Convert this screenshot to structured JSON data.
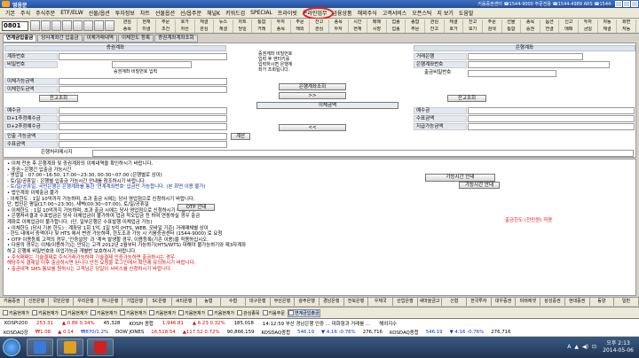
{
  "titlebar": {
    "title": "영웅문",
    "info": "키움증권센터  ☎1544-9000 주문전용 ☎1544-4989 ARS ☎1544-"
  },
  "menu": [
    "기본",
    "주식",
    "주식주문",
    "ETF/ELW",
    "선물/옵션",
    "투자정보",
    "차트",
    "선물옵션",
    "선/옵주문",
    "채널K",
    "키워드검",
    "SPECIAL",
    "프라이빗",
    "온라인업무",
    "금융상품",
    "해외주식",
    "고객서비스",
    "오픈스틱",
    "지 보기",
    "도움말"
  ],
  "account_number": "0801",
  "quick": [
    "관심",
    "현재",
    "주문",
    "호가",
    "체결",
    "뉴스",
    "차트",
    "통합",
    "투자",
    "주문",
    "잔고",
    "종목",
    "시간",
    "매매",
    "업종",
    "종합",
    "관심",
    "체결",
    "잔고",
    "주문",
    "선물",
    "종목",
    "옵션",
    "신고",
    "투자",
    "자동",
    "화면",
    "종목",
    "미결",
    "조건",
    "자산",
    "관심",
    "체결",
    "당일",
    "거래",
    "종목",
    "해외",
    "관심",
    "투자",
    "현재",
    "시장",
    "업종",
    "주문",
    "잔고",
    "호가",
    "보기",
    "검색",
    "통합",
    "증권",
    "연결",
    "매매",
    "금일",
    "체결",
    "자동"
  ],
  "tabs": [
    "연계금입출금",
    "당사계좌간 입출금",
    "이체거래내역",
    "이체한도 등록",
    "증권계좌계좌조회"
  ],
  "panel": {
    "left_header": "증권계좌",
    "account_label": "계좌번호",
    "password_label": "비밀번호",
    "password_hint": "증권계좌 비밀번호 입력",
    "transfer_available_label": "이체가능금액",
    "transfer_limit_label": "이체한도금액",
    "balance_btn": "잔고조회",
    "deposit_label": "예수금",
    "d1_label": "D+1추정예수금",
    "d2_label": "D+2추정예수금",
    "withdraw_label": "인출 가능금액",
    "fee_label": "수표금액",
    "calc_btn": "계산",
    "bank_message_label": "은행처리메시지",
    "mid_text": [
      "증권계좌 비밀번호",
      "입력 후 엔터키를",
      "입력하시면 은행계",
      "좌가 조회됩니다."
    ],
    "mid_btn_query": "은행계좌조회",
    "mid_btn_right": ">>",
    "mid_btn_amount": "이체금액",
    "mid_btn_left": "<<",
    "right_header": "은행계좌",
    "bank_name_label": "거래은행",
    "bank_account_label": "은행계좌번호",
    "bank_pw_label": "출금비밀번호",
    "right_balance_btn": "잔고조회",
    "bank_deposit_label": "예수금",
    "bank_fee_label": "수표금액",
    "bank_withdraw_label": "지급가능금액"
  },
  "notes": [
    {
      "t": "• 이체 전송 후 은행계좌 및 증권계좌의 이체내역을 확인하시기 바랍니다.",
      "c": ""
    },
    {
      "t": "• 증권~은행간 입출금 가능시간",
      "c": ""
    },
    {
      "t": "   - 영업일 : 07:00~16:50, 17:00~23:30, 00:30~07:00 (은행별로 상이)",
      "c": ""
    },
    {
      "t": "   - 토/일/공휴일 : 은행별 입출금 가능시간 안내를 참조하시기 바랍니다.",
      "c": ""
    },
    {
      "t": "   - 토/일/공휴일, 국민은행은 은행계좌를 통한 '연계계좌번호' 입금만 가능합니다. (본 화면 이용 불가)",
      "c": "blue"
    },
    {
      "t": "• 법인계좌 이체출금 불가",
      "c": ""
    },
    {
      "t": "   - 이체한도 : 1일 10억까지 가능하며, 초과 출금 시에는 당사 영업점으로 신청하시기 바랍니다.",
      "c": ""
    },
    {
      "t": "                         단, 법인은 평일(17:00~23:30), 새벽(00:30~07:00), 토/일/공휴일",
      "c": ""
    },
    {
      "t": "• 이체한도 : 1일 10억까지 가능하며, 초과 출금 시에는 당사 영업점으로 신청하시기 바랍니다.",
      "c": ""
    },
    {
      "t": "• 은행처리결과 수표법금은 당사 이체업금이 불가하여 업금 착오입금 전 하여 연동하실 경우 출금",
      "c": ""
    },
    {
      "t": "   계좌로 이체업금이 불가합니다. (단, 일부은행은 수표발행 이체업금 가능)",
      "c": ""
    },
    {
      "t": "• 이체한도 (당사 기본 한도) : 계좌당 1회 1억, 1일 5억 (HTS, WEB, 모바일 기준) 거래매체별 상이",
      "c": ""
    },
    {
      "t": "   - 한도 내에서 증액이나 및 HTS 에서 변경 가능하며, 한도조과 가능 시 키움증권센터 (1544-9000) 로 요청",
      "c": ""
    },
    {
      "t": "• OTP 이용등록 고객의 경우, '인증설정' 과 '계속 발생할 경우, 이용등록(기존 이용)을 적용하십시오.",
      "c": ""
    },
    {
      "t": "• 다음의 경우는 이체(이용하기)는 안되는 고객 2012년 2월부터 가능하기(HTS/WTS) 대해야 불가능하기와 제3자계좌",
      "c": ""
    },
    {
      "t": "   하고 은행에 비밀번호와 이업가능금 개별번 보호하시기 바랍니다.",
      "c": ""
    },
    {
      "t": "• 주식매매는 기술결제로 주식거래가능하며 기술결제 인증가능하면 출금하시는 경우",
      "c": "red"
    },
    {
      "t": "   해당주식 결제일 이후 출금하시면 된니다.안전 요청을 로그인에서 확인에 유의하시기 바랍니다.",
      "c": "red"
    },
    {
      "t": "• 출금내역 SMS 통보를 원하시는 고객님은 당일이 서비스를 신청하시기 바랍니다.",
      "c": "red"
    }
  ],
  "access_btn": "가능시간 안내",
  "access_btn2": "가능시간 안내",
  "otp_btn": "OTP 안내",
  "notice": "출금한도 (천만원) 적용",
  "tickers": [
    "키움증권",
    "신한은행",
    "국민은행",
    "우리은행",
    "하나은행",
    "기업은행",
    "SC은행",
    "씨티은행",
    "농협",
    "수협",
    "대구은행",
    "부산은행",
    "광주은행",
    "경남은행",
    "전북은행",
    "우체국",
    "산업은행",
    "새마을금고",
    "신협",
    "한국투자",
    "대우증권",
    "미래에셋",
    "삼성증권",
    "현대증권",
    "동양",
    "일반"
  ],
  "windows": [
    {
      "label": "키움현재가",
      "act": false
    },
    {
      "label": "키움현재가",
      "act": false
    },
    {
      "label": "키움현재가",
      "act": false
    },
    {
      "label": "키움현재가",
      "act": false
    },
    {
      "label": "키움현재가",
      "act": false
    },
    {
      "label": "키움현재가",
      "act": false
    },
    {
      "label": "키움현재가",
      "act": false
    },
    {
      "label": "키움현재가",
      "act": false
    },
    {
      "label": "관심종목",
      "act": false
    },
    {
      "label": "키움주문",
      "act": false
    },
    {
      "label": "연계금입출금",
      "act": true
    }
  ],
  "market_row1": [
    {
      "t": "KOSPI200",
      "c": ""
    },
    {
      "t": "253.31",
      "c": "up"
    },
    {
      "t": "▲ 0.86 0.34%",
      "c": "up"
    },
    {
      "t": "45,328",
      "c": ""
    },
    {
      "t": "KOSPI 종합",
      "c": ""
    },
    {
      "t": "1,946.81",
      "c": "up"
    },
    {
      "t": "▲ 6.23 0.32%",
      "c": "up"
    },
    {
      "t": "185,018",
      "c": ""
    },
    {
      "t": "14:12:59  부산 경남은행 인증 …  대화형과 거래를 …",
      "c": ""
    },
    {
      "t": "해외지수",
      "c": ""
    }
  ],
  "market_row2": [
    {
      "t": "KOSDAQ장",
      "c": ""
    },
    {
      "t": "₩1.08",
      "c": "up"
    },
    {
      "t": "▲ 0.14",
      "c": "up"
    },
    {
      "t": "₩870/1.2%",
      "c": "dn"
    },
    {
      "t": "DOW JONES",
      "c": ""
    },
    {
      "t": "16,518.54",
      "c": "up"
    },
    {
      "t": "▲117.52 0.72%",
      "c": "up"
    },
    {
      "t": "90,866,159",
      "c": ""
    },
    {
      "t": "KOSDAQ종합",
      "c": ""
    },
    {
      "t": "546.19",
      "c": "dn"
    },
    {
      "t": "▼ 4.16 -0.76%",
      "c": "dn"
    },
    {
      "t": "276,716",
      "c": ""
    },
    {
      "t": "KOSDAQ종합",
      "c": ""
    },
    {
      "t": "546.19",
      "c": "dn"
    },
    {
      "t": "▼ 4.16 -0.76%",
      "c": "dn"
    },
    {
      "t": "276,716",
      "c": ""
    }
  ],
  "clock": {
    "time": "오후 2:13",
    "date": "2014-05-06"
  },
  "tray": [
    "A",
    "▲",
    "◀)",
    "⊡"
  ]
}
